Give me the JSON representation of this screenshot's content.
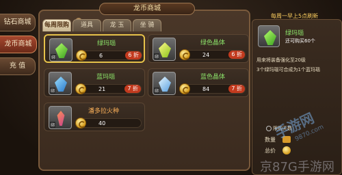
{
  "sidebar": {
    "items": [
      {
        "label": "钻石商城"
      },
      {
        "label": "龙币商城"
      },
      {
        "label": "充 值"
      }
    ]
  },
  "header": {
    "title": "龙币商城"
  },
  "tabs": [
    {
      "label": "每周限购"
    },
    {
      "label": "道具"
    },
    {
      "label": "龙 玉"
    },
    {
      "label": "坐 骑"
    }
  ],
  "refresh_note": "每周一早上5点刷新",
  "items": [
    {
      "name": "绿玛瑙",
      "price": "6",
      "discount": "6 折",
      "gem": "green",
      "bind": "绑"
    },
    {
      "name": "绿色晶体",
      "price": "24",
      "discount": "6 折",
      "gem": "yellowgreen",
      "bind": "绑"
    },
    {
      "name": "蓝玛瑙",
      "price": "21",
      "discount": "7 折",
      "gem": "blue",
      "bind": "绑"
    },
    {
      "name": "蓝色晶体",
      "price": "84",
      "discount": "7 折",
      "gem": "lightblue",
      "bind": "绑"
    },
    {
      "name": "潘多拉火种",
      "price": "40",
      "discount": "",
      "gem": "torch",
      "bind": "绑"
    }
  ],
  "detail": {
    "name": "绿玛瑙",
    "remain": "还可购买60个",
    "desc1": "用来将装备强化至20级",
    "desc2": "3个绿玛瑙可合成为1个蓝玛瑙",
    "limit": "限购天数",
    "qty_label": "数量",
    "total_label": "总价"
  },
  "watermark": {
    "text1": "手游网",
    "text2": "9870.com",
    "text3": "京87G手游网"
  },
  "colors": {
    "accent": "#e6c24a",
    "active_nav": "#a6472e",
    "green_text": "#8ce36a",
    "orange_text": "#ffb35a"
  }
}
